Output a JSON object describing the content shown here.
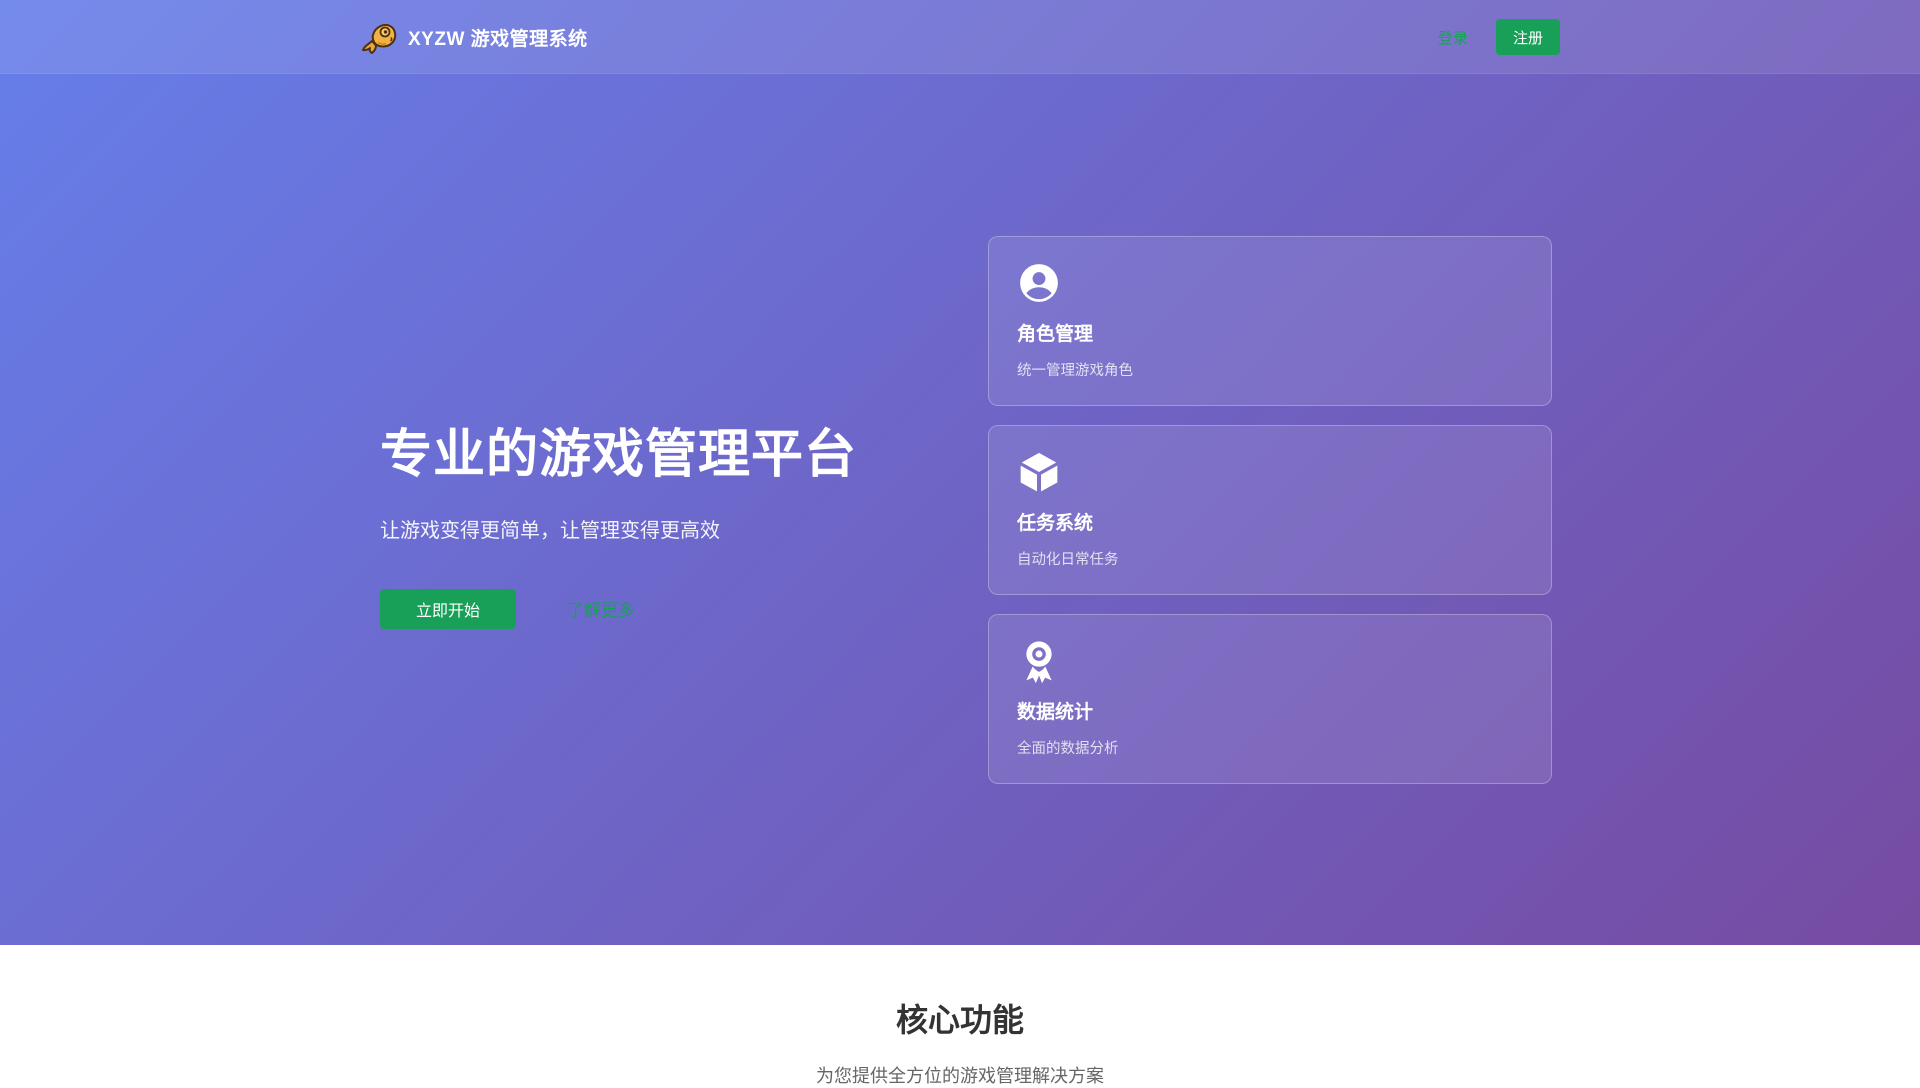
{
  "header": {
    "brand": "XYZW 游戏管理系统",
    "login_label": "登录",
    "register_label": "注册"
  },
  "hero": {
    "title": "专业的游戏管理平台",
    "subtitle": "让游戏变得更简单，让管理变得更高效",
    "primary_cta": "立即开始",
    "secondary_cta": "了解更多",
    "cards": [
      {
        "icon": "person-circle-icon",
        "title": "角色管理",
        "desc": "统一管理游戏角色"
      },
      {
        "icon": "cube-icon",
        "title": "任务系统",
        "desc": "自动化日常任务"
      },
      {
        "icon": "medal-icon",
        "title": "数据统计",
        "desc": "全面的数据分析"
      }
    ]
  },
  "features": {
    "title": "核心功能",
    "subtitle": "为您提供全方位的游戏管理解决方案"
  },
  "colors": {
    "gradient_start": "#667eea",
    "gradient_end": "#764ba2",
    "accent": "#18a058",
    "header_overlay": "rgba(255,255,255,0.10)",
    "features_title": "#333333",
    "features_subtitle": "#666666"
  }
}
